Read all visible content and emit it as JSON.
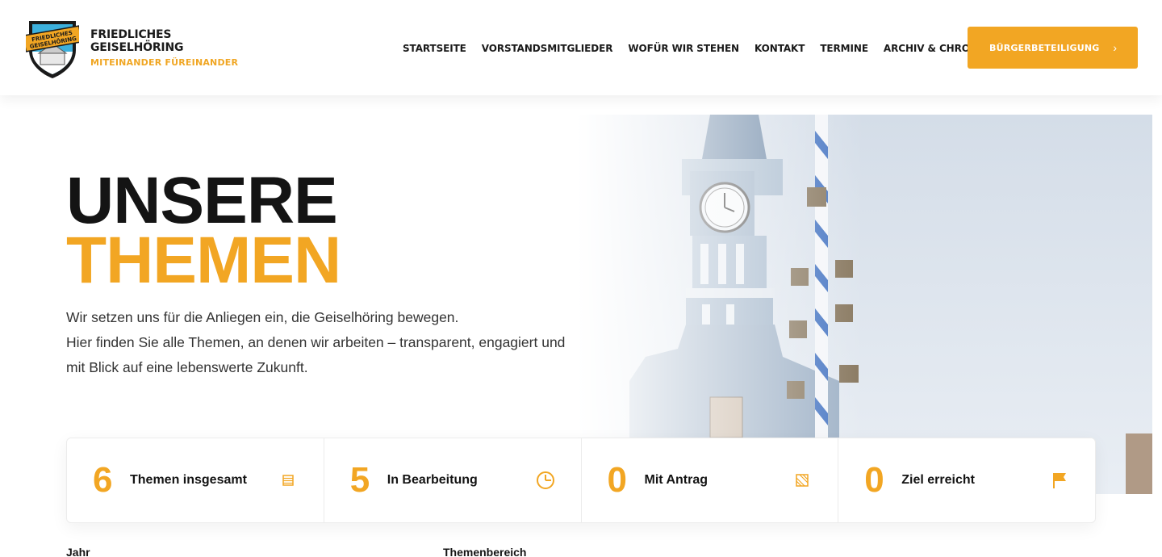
{
  "header": {
    "brand_name_line1": "FRIEDLICHES",
    "brand_name_line2": "GEISELHÖRING",
    "brand_tagline": "MITEINANDER FÜREINANDER",
    "logo_text_line1": "FRIEDLICHES",
    "logo_text_line2": "GEISELHÖRING",
    "nav": [
      {
        "label": "STARTSEITE"
      },
      {
        "label": "VORSTANDSMITGLIEDER"
      },
      {
        "label": "WOFÜR WIR STEHEN"
      },
      {
        "label": "KONTAKT"
      },
      {
        "label": "TERMINE"
      },
      {
        "label": "ARCHIV & CHRONIK"
      }
    ],
    "cta_label": "BÜRGERBETEILIGUNG",
    "cta_arrow": "›"
  },
  "hero": {
    "title_line1": "UNSERE",
    "title_line2": "THEMEN",
    "text_line1": "Wir setzen uns für die Anliegen ein, die Geiselhöring bewegen.",
    "text_line2": "Hier finden Sie alle Themen, an denen wir arbeiten – transparent, engagiert und",
    "text_line3": "mit Blick auf eine lebenswerte Zukunft."
  },
  "stats": [
    {
      "value": "6",
      "label": "Themen insgesamt",
      "icon": "list-icon"
    },
    {
      "value": "5",
      "label": "In Bearbeitung",
      "icon": "clock-icon"
    },
    {
      "value": "0",
      "label": "Mit Antrag",
      "icon": "document-icon"
    },
    {
      "value": "0",
      "label": "Ziel erreicht",
      "icon": "flag-icon"
    }
  ],
  "filters": {
    "year_label": "Jahr",
    "topic_label": "Themenbereich"
  },
  "colors": {
    "accent": "#f2a623",
    "dark": "#141414",
    "sky": "#c9d6e4",
    "tower": "#8fa6bf"
  }
}
